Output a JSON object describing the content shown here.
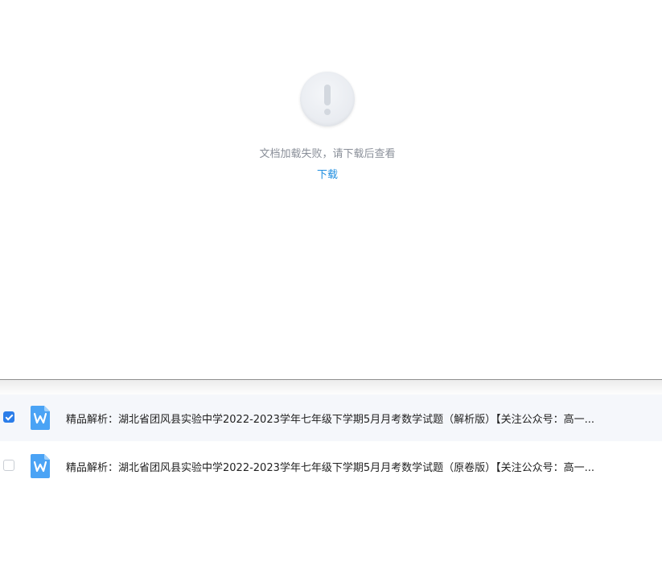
{
  "preview": {
    "error_message": "文档加载失败，请下载后查看",
    "download_label": "下载",
    "icon": "exclamation-icon"
  },
  "files": [
    {
      "name": "精品解析：湖北省团风县实验中学2022-2023学年七年级下学期5月月考数学试题（解析版）【关注公众号：高一...",
      "checked": true,
      "icon": "word-doc-icon"
    },
    {
      "name": "精品解析：湖北省团风县实验中学2022-2023学年七年级下学期5月月考数学试题（原卷版）【关注公众号：高一...",
      "checked": false,
      "icon": "word-doc-icon"
    }
  ],
  "colors": {
    "accent": "#2b7de9",
    "link": "#1f8ee0",
    "word_icon": "#4aa3f5"
  }
}
